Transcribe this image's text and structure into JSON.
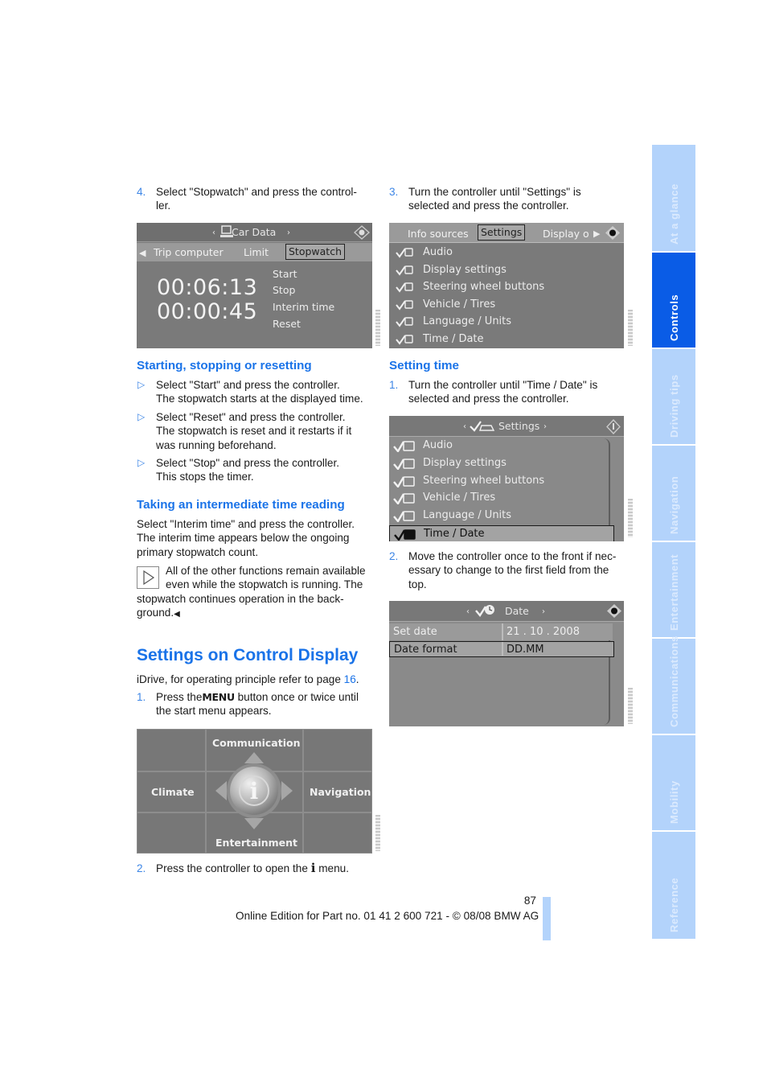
{
  "left_column": {
    "step4": {
      "num": "4.",
      "line1": "Select \"Stopwatch\" and press the control-",
      "line2": "ler."
    },
    "stopwatch_screen": {
      "title": "Car Data",
      "tabs": [
        "Trip computer",
        "Limit",
        "Stopwatch"
      ],
      "selected_tab": "Stopwatch",
      "time_primary": "00:06:13",
      "time_interim": "00:00:45",
      "menu": [
        "Start",
        "Stop",
        "Interim time",
        "Reset"
      ]
    },
    "section_start": {
      "heading": "Starting, stopping or resetting",
      "bullets": [
        {
          "line1": "Select \"Start\" and press the controller.",
          "line2": "The stopwatch starts at the displayed time.",
          "line3": ""
        },
        {
          "line1": "Select \"Reset\" and press the controller.",
          "line2": "The stopwatch is reset and it restarts if it",
          "line3": "was running beforehand."
        },
        {
          "line1": "Select \"Stop\" and press the controller.",
          "line2": "This stops the timer.",
          "line3": ""
        }
      ]
    },
    "section_interim": {
      "heading": "Taking an intermediate time reading",
      "para": [
        "Select \"Interim time\" and press the controller.",
        "The interim time appears below the ongoing",
        "primary stopwatch count."
      ],
      "note": [
        "All of the other functions remain available",
        "even while the stopwatch is running. The",
        "stopwatch continues operation in the back-",
        "ground."
      ]
    },
    "section_settings": {
      "heading": "Settings on Control Display",
      "intro_prefix": "iDrive, for operating principle refer to page ",
      "intro_link": "16",
      "intro_suffix": ".",
      "step1": {
        "num": "1.",
        "prefix": "Press the",
        "menu_key": "MENU",
        "suffix": "button once or twice until",
        "line2": "the start menu appears."
      },
      "imenu_screen": {
        "top": "Communication",
        "left": "Climate",
        "right": "Navigation",
        "bottom": "Entertainment",
        "center_icon": "i"
      },
      "step2": {
        "num": "2.",
        "prefix": "Press the controller to open the",
        "icon": "i",
        "suffix": "menu."
      }
    }
  },
  "right_column": {
    "step3": {
      "num": "3.",
      "line1": "Turn the controller until \"Settings\" is",
      "line2": "selected and press the controller."
    },
    "settings_tab_screen": {
      "tabs": [
        "Info sources",
        "Settings",
        "Display o"
      ],
      "selected_tab": "Settings",
      "items": [
        {
          "label": "Audio",
          "icon": "audio-icon"
        },
        {
          "label": "Display settings",
          "icon": "display-icon"
        },
        {
          "label": "Steering wheel buttons",
          "icon": "steering-wheel-icon"
        },
        {
          "label": "Vehicle / Tires",
          "icon": "vehicle-icon"
        },
        {
          "label": "Language / Units",
          "icon": "flag-icon"
        },
        {
          "label": "Time / Date",
          "icon": "clock-icon"
        }
      ]
    },
    "section_time": {
      "heading": "Setting time",
      "step1": {
        "num": "1.",
        "line1": "Turn the controller until \"Time / Date\" is",
        "line2": "selected and press the controller."
      },
      "settings_screen": {
        "title": "Settings",
        "items": [
          "Audio",
          "Display settings",
          "Steering wheel buttons",
          "Vehicle / Tires",
          "Language / Units",
          "Time / Date"
        ],
        "selected": "Time / Date"
      },
      "step2": {
        "num": "2.",
        "line1": "Move the controller once to the front if nec-",
        "line2": "essary to change to the first field from the",
        "line3": "top."
      },
      "date_screen": {
        "title": "Date",
        "rows": [
          {
            "label": "Set date",
            "value": "21 . 10 . 2008"
          },
          {
            "label": "Date format",
            "value": "DD.MM"
          }
        ],
        "selected": "Date format"
      }
    }
  },
  "footer": {
    "page_number": "87",
    "edition": "Online Edition for Part no. 01 41 2 600 721 - © 08/08 BMW AG"
  },
  "side_tabs": [
    {
      "label": "At a glance",
      "active": false
    },
    {
      "label": "Controls",
      "active": true
    },
    {
      "label": "Driving tips",
      "active": false
    },
    {
      "label": "Navigation",
      "active": false
    },
    {
      "label": "Entertainment",
      "active": false
    },
    {
      "label": "Communications",
      "active": false
    },
    {
      "label": "Mobility",
      "active": false
    },
    {
      "label": "Reference",
      "active": false
    }
  ],
  "colors": {
    "accent": "#1a73e8",
    "side_tab": "#b3d3fb",
    "side_tab_active": "#0a5ce6",
    "screen_gray": "#7a7a7a"
  }
}
